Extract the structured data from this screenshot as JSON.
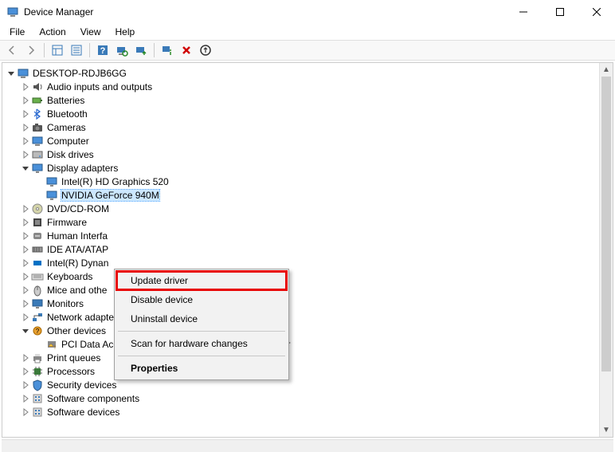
{
  "window": {
    "title": "Device Manager"
  },
  "menubar": {
    "items": [
      "File",
      "Action",
      "View",
      "Help"
    ]
  },
  "toolbar": {
    "buttons": [
      {
        "name": "back-icon"
      },
      {
        "name": "forward-icon"
      },
      {
        "name": "sep"
      },
      {
        "name": "show-hide-tree-icon"
      },
      {
        "name": "properties-icon"
      },
      {
        "name": "sep"
      },
      {
        "name": "help-icon"
      },
      {
        "name": "scan-hardware-icon"
      },
      {
        "name": "update-driver-icon"
      },
      {
        "name": "sep"
      },
      {
        "name": "uninstall-icon"
      },
      {
        "name": "disable-icon"
      },
      {
        "name": "enable-icon"
      }
    ]
  },
  "tree": {
    "root": {
      "label": "DESKTOP-RDJB6GG",
      "expanded": true,
      "icon": "computer-icon",
      "children": [
        {
          "label": "Audio inputs and outputs",
          "icon": "audio-icon",
          "expandable": true
        },
        {
          "label": "Batteries",
          "icon": "battery-icon",
          "expandable": true
        },
        {
          "label": "Bluetooth",
          "icon": "bluetooth-icon",
          "expandable": true
        },
        {
          "label": "Cameras",
          "icon": "camera-icon",
          "expandable": true
        },
        {
          "label": "Computer",
          "icon": "computer-icon",
          "expandable": true
        },
        {
          "label": "Disk drives",
          "icon": "disk-icon",
          "expandable": true
        },
        {
          "label": "Display adapters",
          "icon": "display-icon",
          "expandable": true,
          "expanded": true,
          "children": [
            {
              "label": "Intel(R) HD Graphics 520",
              "icon": "display-icon"
            },
            {
              "label": "NVIDIA GeForce 940M",
              "icon": "display-icon",
              "selected": true
            }
          ]
        },
        {
          "label": "DVD/CD-ROM",
          "icon": "dvd-icon",
          "expandable": true,
          "truncated": true
        },
        {
          "label": "Firmware",
          "icon": "firmware-icon",
          "expandable": true
        },
        {
          "label": "Human Interfa",
          "icon": "hid-icon",
          "expandable": true,
          "truncated": true
        },
        {
          "label": "IDE ATA/ATAP",
          "icon": "ide-icon",
          "expandable": true,
          "truncated": true
        },
        {
          "label": "Intel(R) Dynan",
          "icon": "intel-icon",
          "expandable": true,
          "truncated": true
        },
        {
          "label": "Keyboards",
          "icon": "keyboard-icon",
          "expandable": true
        },
        {
          "label": "Mice and othe",
          "icon": "mouse-icon",
          "expandable": true,
          "truncated": true
        },
        {
          "label": "Monitors",
          "icon": "monitor-icon",
          "expandable": true
        },
        {
          "label": "Network adapters",
          "icon": "network-icon",
          "expandable": true
        },
        {
          "label": "Other devices",
          "icon": "other-icon",
          "expandable": true,
          "expanded": true,
          "children": [
            {
              "label": "PCI Data Acquisition and Signal Processing Controller",
              "icon": "warning-icon"
            }
          ]
        },
        {
          "label": "Print queues",
          "icon": "printer-icon",
          "expandable": true
        },
        {
          "label": "Processors",
          "icon": "processor-icon",
          "expandable": true
        },
        {
          "label": "Security devices",
          "icon": "security-icon",
          "expandable": true
        },
        {
          "label": "Software components",
          "icon": "software-icon",
          "expandable": true
        },
        {
          "label": "Software devices",
          "icon": "software-icon",
          "expandable": true
        }
      ]
    }
  },
  "context_menu": {
    "items": [
      {
        "label": "Update driver",
        "highlighted": true
      },
      {
        "label": "Disable device"
      },
      {
        "label": "Uninstall device"
      },
      {
        "sep": true
      },
      {
        "label": "Scan for hardware changes"
      },
      {
        "sep": true
      },
      {
        "label": "Properties",
        "bold": true
      }
    ]
  }
}
